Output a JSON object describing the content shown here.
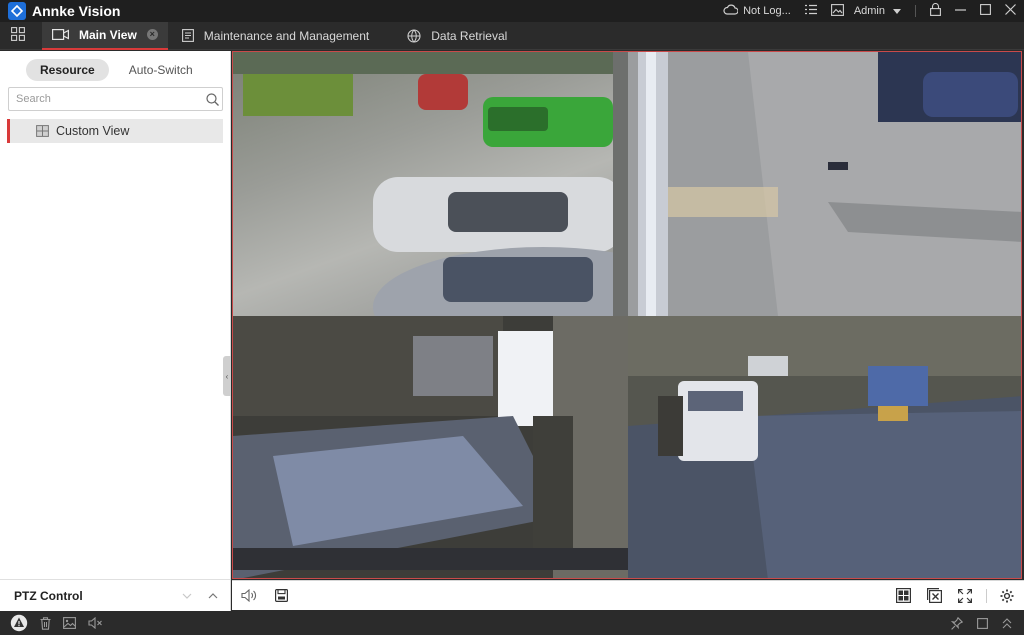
{
  "titlebar": {
    "app_title": "Annke Vision",
    "cloud_status": "Not Log...",
    "user": "Admin",
    "icons": [
      "cloud-icon",
      "list-icon",
      "image-icon",
      "lock-icon",
      "minimize-icon",
      "maximize-icon",
      "close-icon"
    ]
  },
  "tabs": [
    {
      "label": "Main View",
      "active": true,
      "icon": "camera-icon"
    },
    {
      "label": "Maintenance and Management",
      "active": false,
      "icon": "document-icon"
    },
    {
      "label": "Data Retrieval",
      "active": false,
      "icon": "globe-icon"
    }
  ],
  "left_panel": {
    "segments": [
      "Resource",
      "Auto-Switch"
    ],
    "active_segment": "Resource",
    "search": {
      "placeholder": "Search",
      "value": ""
    },
    "tree": [
      {
        "label": "Custom View",
        "icon": "view-icon",
        "selected": true
      }
    ],
    "ptz_label": "PTZ Control"
  },
  "video": {
    "layout": "2x2",
    "tiles": [
      {
        "osd": ""
      },
      {
        "osd": ""
      },
      {
        "osd": ""
      },
      {
        "osd": ""
      }
    ]
  },
  "toolbar": {
    "left_icons": [
      "volume-icon",
      "save-icon"
    ],
    "right_icons": [
      "layout-icon",
      "close-all-icon",
      "fullscreen-icon",
      "settings-icon"
    ]
  },
  "statusbar": {
    "left_icons": [
      "alarm-icon",
      "delete-icon",
      "image-icon",
      "mute-icon"
    ],
    "right_icons": [
      "pin-icon",
      "window-icon",
      "expand-up-icon"
    ]
  },
  "colors": {
    "accent": "#d93a3a",
    "brand": "#1e6fd9",
    "chrome": "#2b2b2b"
  }
}
